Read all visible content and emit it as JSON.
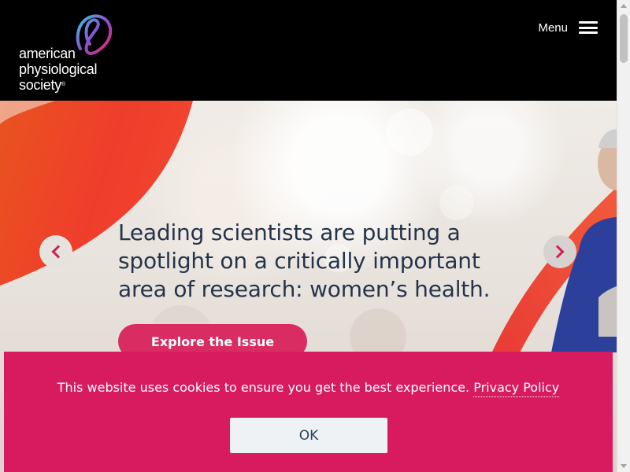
{
  "header": {
    "logo": {
      "line1": "american",
      "line2": "physiological",
      "line3": "society",
      "registered": "®"
    },
    "menu_label": "Menu"
  },
  "hero": {
    "headline": "Leading scientists are putting a spotlight on a critically important area of research: women’s health.",
    "cta_label": "Explore the Issue"
  },
  "cookie_banner": {
    "message": "This website uses cookies to ensure you get the best experience.",
    "link_label": "Privacy Policy",
    "ok_label": "OK"
  },
  "colors": {
    "header_bg": "#000000",
    "accent_pink": "#d81b5e",
    "accent_orange": "#ee5a24",
    "headline_text": "#24344a",
    "ok_button_bg": "#eef2f4"
  },
  "icons": [
    "logo-mark-icon",
    "hamburger-icon",
    "chevron-left-icon",
    "chevron-right-icon"
  ]
}
